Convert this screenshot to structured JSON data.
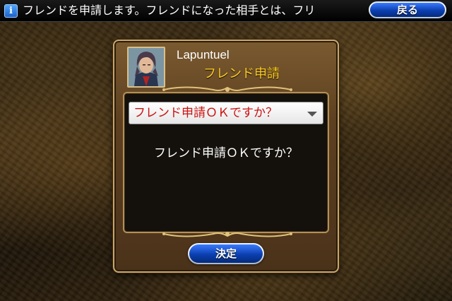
{
  "ticker": {
    "icon": "info-icon",
    "icon_glyph": "i",
    "text": "フレンドを申請します。フレンドになった相手とは、フリ",
    "back_label": "戻る"
  },
  "dialog": {
    "player_name": "Lapuntuel",
    "subtitle": "フレンド申請",
    "portrait_icon": "character-portrait",
    "dropdown": {
      "selected": "フレンド申請ＯＫですか？",
      "caret_icon": "chevron-down-icon"
    },
    "message": "フレンド申請ＯＫですか？",
    "confirm_label": "決定"
  },
  "colors": {
    "subtitle": "#ffcc22",
    "dropdown_text": "#cc1111",
    "button_blue": "#0b3fb0",
    "frame_gold": "#c9a76a"
  }
}
